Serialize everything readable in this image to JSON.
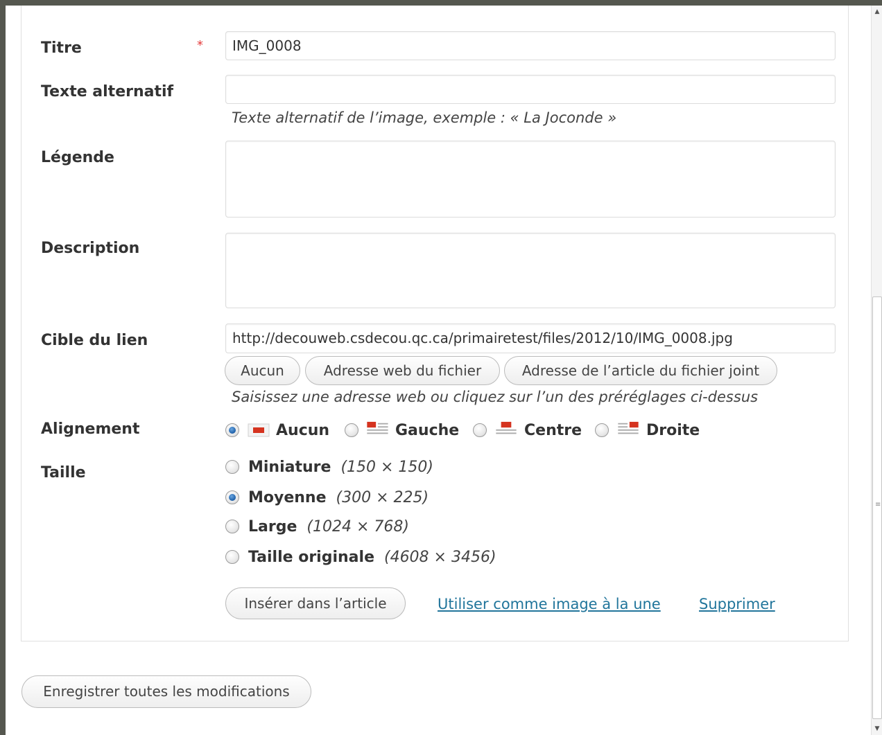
{
  "form": {
    "title": {
      "label": "Titre",
      "required_mark": "*",
      "value": "IMG_0008"
    },
    "alt_text": {
      "label": "Texte alternatif",
      "value": "",
      "hint": "Texte alternatif de l’image, exemple : « La Joconde »"
    },
    "caption": {
      "label": "Légende",
      "value": ""
    },
    "description": {
      "label": "Description",
      "value": ""
    },
    "link_target": {
      "label": "Cible du lien",
      "value": "http://decouweb.csdecou.qc.ca/primairetest/files/2012/10/IMG_0008.jpg",
      "buttons": {
        "none": "Aucun",
        "file_url": "Adresse web du fichier",
        "post_url": "Adresse de l’article du fichier joint"
      },
      "hint": "Saisissez une adresse web ou cliquez sur l’un des préréglages ci-dessus"
    },
    "alignment": {
      "label": "Alignement",
      "selected": "Aucun",
      "options": [
        {
          "label": "Aucun",
          "icon": "align-none-icon"
        },
        {
          "label": "Gauche",
          "icon": "align-left-icon"
        },
        {
          "label": "Centre",
          "icon": "align-center-icon"
        },
        {
          "label": "Droite",
          "icon": "align-right-icon"
        }
      ]
    },
    "size": {
      "label": "Taille",
      "selected": "Moyenne",
      "options": [
        {
          "label": "Miniature",
          "dims": "(150 × 150)"
        },
        {
          "label": "Moyenne",
          "dims": "(300 × 225)"
        },
        {
          "label": "Large",
          "dims": "(1024 × 768)"
        },
        {
          "label": "Taille originale",
          "dims": "(4608 × 3456)"
        }
      ]
    },
    "actions": {
      "insert": "Insérer dans l’article",
      "featured": "Utiliser comme image à la une",
      "delete": "Supprimer"
    }
  },
  "footer": {
    "save_all": "Enregistrer toutes les modifications"
  },
  "colors": {
    "accent_link": "#21759b",
    "required": "#e43b3b",
    "radio_checked": "#1d5fa8",
    "icon_red": "#d5331f"
  }
}
